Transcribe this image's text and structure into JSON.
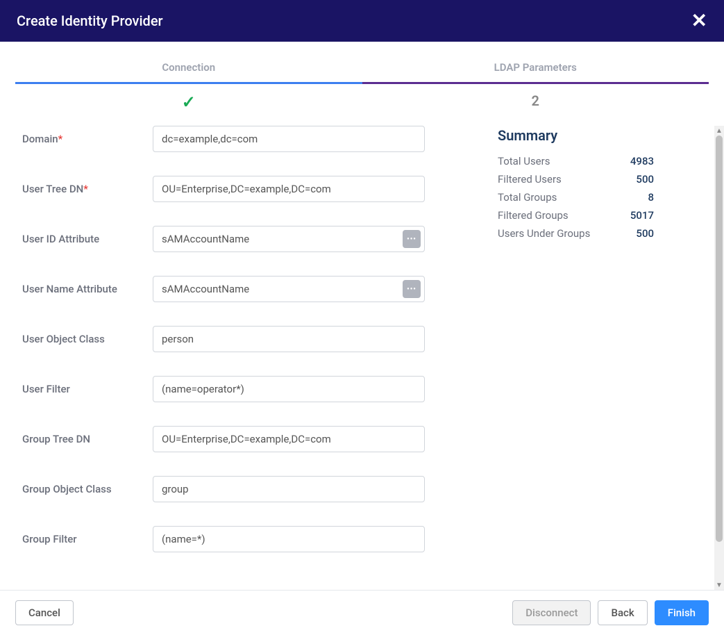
{
  "header": {
    "title": "Create Identity Provider"
  },
  "tabs": {
    "connection": "Connection",
    "ldap": "LDAP Parameters",
    "step2": "2"
  },
  "form": {
    "domain": {
      "label": "Domain",
      "value": "dc=example,dc=com"
    },
    "userTreeDn": {
      "label": "User Tree DN",
      "value": "OU=Enterprise,DC=example,DC=com"
    },
    "userIdAttr": {
      "label": "User ID Attribute",
      "value": "sAMAccountName"
    },
    "userNameAttr": {
      "label": "User Name Attribute",
      "value": "sAMAccountName"
    },
    "userObjClass": {
      "label": "User Object Class",
      "value": "person"
    },
    "userFilter": {
      "label": "User Filter",
      "value": "(name=operator*)"
    },
    "groupTreeDn": {
      "label": "Group Tree DN",
      "value": "OU=Enterprise,DC=example,DC=com"
    },
    "groupObjClass": {
      "label": "Group Object Class",
      "value": "group"
    },
    "groupFilter": {
      "label": "Group Filter",
      "value": "(name=*)"
    }
  },
  "summary": {
    "title": "Summary",
    "rows": [
      {
        "label": "Total Users",
        "value": "4983"
      },
      {
        "label": "Filtered Users",
        "value": "500"
      },
      {
        "label": "Total Groups",
        "value": "8"
      },
      {
        "label": "Filtered Groups",
        "value": "5017"
      },
      {
        "label": "Users Under Groups",
        "value": "500"
      }
    ]
  },
  "buttons": {
    "cancel": "Cancel",
    "disconnect": "Disconnect",
    "back": "Back",
    "finish": "Finish"
  },
  "required_mark": "*"
}
